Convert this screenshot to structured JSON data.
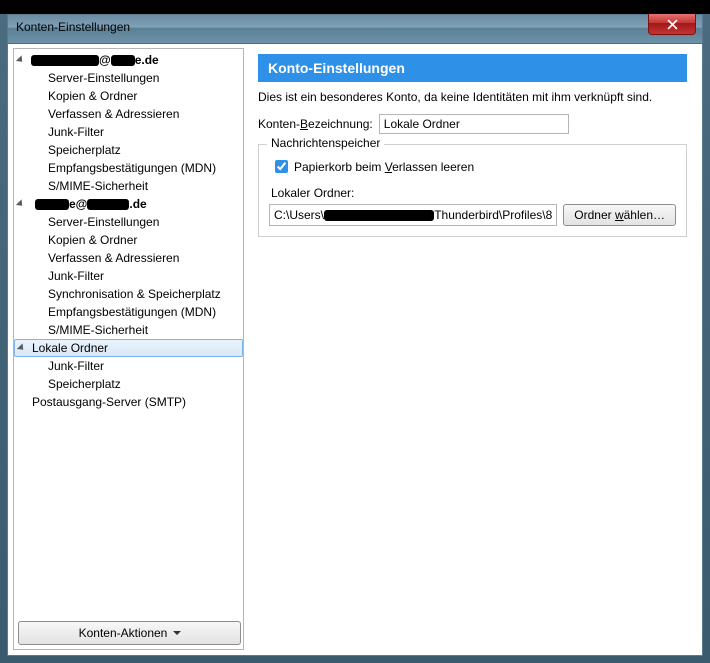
{
  "window": {
    "title": "Konten-Einstellungen"
  },
  "sidebar": {
    "accounts": [
      {
        "email_prefix_redacted_w": 68,
        "email_mid": "@",
        "email_suffix_redacted_w": 24,
        "email_suffix": "e.de",
        "items": [
          "Server-Einstellungen",
          "Kopien & Ordner",
          "Verfassen & Adressieren",
          "Junk-Filter",
          "Speicherplatz",
          "Empfangsbestätigungen (MDN)",
          "S/MIME-Sicherheit"
        ]
      },
      {
        "email_prefix_redacted_w": 34,
        "email_mid": "e@",
        "email_suffix_redacted_w": 42,
        "email_suffix": ".de",
        "items": [
          "Server-Einstellungen",
          "Kopien & Ordner",
          "Verfassen & Adressieren",
          "Junk-Filter",
          "Synchronisation & Speicherplatz",
          "Empfangsbestätigungen (MDN)",
          "S/MIME-Sicherheit"
        ]
      }
    ],
    "local": {
      "label": "Lokale Ordner",
      "items": [
        "Junk-Filter",
        "Speicherplatz"
      ]
    },
    "smtp": "Postausgang-Server (SMTP)",
    "actions_label": "Konten-Aktionen"
  },
  "panel": {
    "heading": "Konto-Einstellungen",
    "description": "Dies ist ein besonderes Konto, da keine Identitäten mit ihm verknüpft sind.",
    "name_label_pre": "Konten-",
    "name_label_u": "B",
    "name_label_post": "ezeichnung:",
    "name_value": "Lokale Ordner",
    "group_legend": "Nachrichtenspeicher",
    "empty_trash_pre": "Papierkorb beim ",
    "empty_trash_u": "V",
    "empty_trash_post": "erlassen leeren",
    "empty_trash_checked": true,
    "local_folder_label": "Lokaler Ordner:",
    "path_prefix": "C:\\Users\\",
    "path_redacted_w": 120,
    "path_suffix": "Thunderbird\\Profiles\\8",
    "browse_pre": "Ordner ",
    "browse_u": "w",
    "browse_post": "ählen…"
  }
}
